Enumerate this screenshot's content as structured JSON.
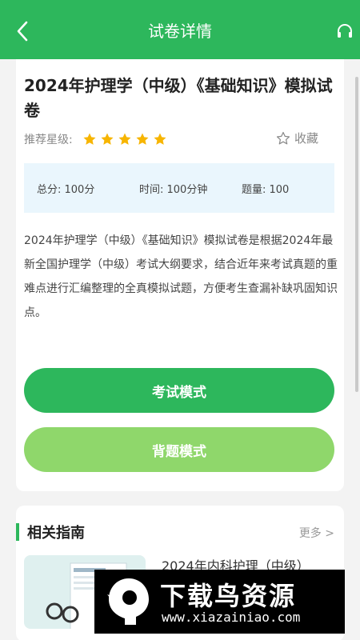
{
  "header": {
    "title": "试卷详情",
    "bg_color": "#2db75c"
  },
  "paper": {
    "title": "2024年护理学（中级）《基础知识》模拟试卷",
    "rating_label": "推荐星级:",
    "rating": 5,
    "favorite_label": "收藏",
    "info": {
      "total_score": "总分: 100分",
      "time": "时间: 100分钟",
      "question_count": "题量: 100"
    },
    "description": "2024年护理学（中级）《基础知识》模拟试卷是根据2024年最新全国护理学（中级）考试大纲要求，结合近年来考试真题的重难点进行汇编整理的全真模拟试题，方便考生查漏补缺巩固知识点。"
  },
  "actions": {
    "exam_mode": "考试模式",
    "recite_mode": "背题模式",
    "exam_color": "#2db75c",
    "recite_color": "#8fd76b"
  },
  "guides": {
    "title": "相关指南",
    "more": "更多 >",
    "items": [
      {
        "title": "2024年内科护理（中级）"
      }
    ]
  },
  "watermark": {
    "text": "下载鸟资源",
    "url": "www.xiazainiao.com"
  },
  "icons": {
    "back": "chevron-left-icon",
    "headset": "headset-icon",
    "star": "star-icon",
    "favorite": "star-outline-icon"
  }
}
